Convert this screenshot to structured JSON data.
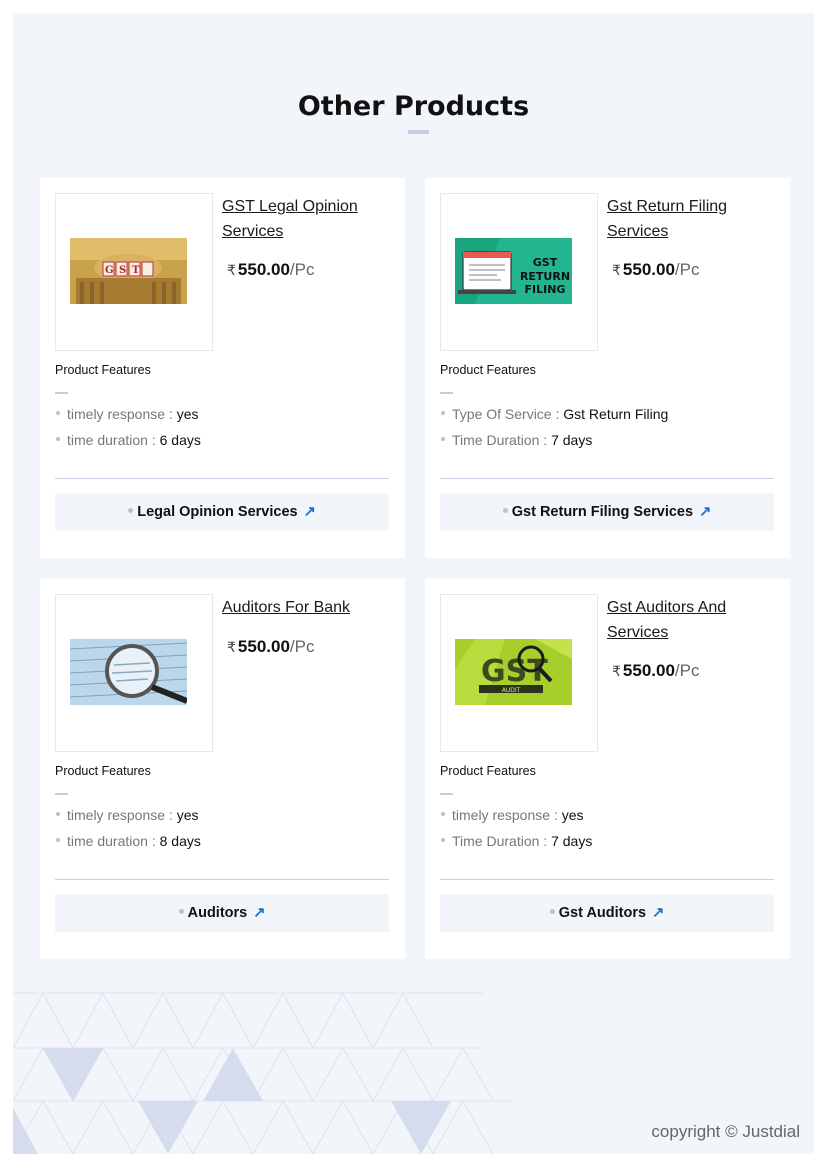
{
  "section": {
    "title": "Other Products"
  },
  "products": [
    {
      "name": "GST Legal Opinion Services",
      "price_symbol": "₹",
      "price": "550.00",
      "unit": "/Pc",
      "image_icon": "gst-building-image",
      "features_label": "Product Features",
      "features": [
        {
          "label": "timely response : ",
          "value": "yes"
        },
        {
          "label": "time duration : ",
          "value": "6 days"
        }
      ],
      "cta": "Legal Opinion Services"
    },
    {
      "name": "Gst Return Filing Services",
      "price_symbol": "₹",
      "price": "550.00",
      "unit": "/Pc",
      "image_icon": "gst-return-filing-image",
      "image_text": "GST RETURN FILING",
      "features_label": "Product Features",
      "features": [
        {
          "label": "Type Of Service : ",
          "value": "Gst Return Filing"
        },
        {
          "label": "Time Duration : ",
          "value": "7 days"
        }
      ],
      "cta": "Gst Return Filing Services"
    },
    {
      "name": "Auditors For Bank",
      "price_symbol": "₹",
      "price": "550.00",
      "unit": "/Pc",
      "image_icon": "magnifier-document-image",
      "features_label": "Product Features",
      "features": [
        {
          "label": "timely response : ",
          "value": "yes"
        },
        {
          "label": "time duration : ",
          "value": "8 days"
        }
      ],
      "cta": "Auditors"
    },
    {
      "name": "Gst Auditors And Services",
      "price_symbol": "₹",
      "price": "550.00",
      "unit": "/Pc",
      "image_icon": "gst-audit-image",
      "image_text": "GST",
      "image_subtext": "AUDIT",
      "features_label": "Product Features",
      "features": [
        {
          "label": "timely response : ",
          "value": "yes"
        },
        {
          "label": "Time Duration : ",
          "value": "7 days"
        }
      ],
      "cta": "Gst Auditors"
    }
  ],
  "footer": {
    "copyright": "copyright © Justdial"
  },
  "colors": {
    "accent": "#1a73c9",
    "page_bg": "#f2f5fa",
    "divider": "#c8d1e4"
  }
}
